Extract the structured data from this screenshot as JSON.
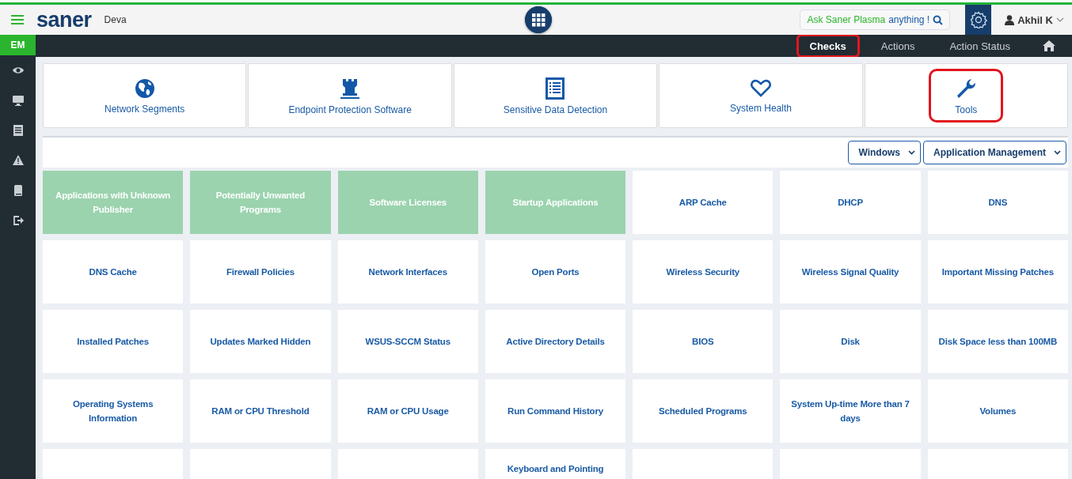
{
  "header": {
    "brand": "saner",
    "workspace": "Deva",
    "ask_prompt": {
      "lead": "Ask Saner Plasma",
      "tail": "anything !"
    },
    "user": "Akhil K"
  },
  "sidebar": {
    "badge": "EM"
  },
  "nav_tabs": [
    {
      "label": "Checks",
      "selected": true,
      "highlighted": true
    },
    {
      "label": "Actions",
      "selected": false,
      "highlighted": false
    },
    {
      "label": "Action Status",
      "selected": false,
      "highlighted": false
    }
  ],
  "categories": [
    {
      "label": "Network Segments",
      "highlighted": false
    },
    {
      "label": "Endpoint Protection Software",
      "highlighted": false
    },
    {
      "label": "Sensitive Data Detection",
      "highlighted": false
    },
    {
      "label": "System Health",
      "highlighted": false
    },
    {
      "label": "Tools",
      "highlighted": true
    }
  ],
  "filters": [
    {
      "value": "Windows"
    },
    {
      "value": "Application Management"
    }
  ],
  "checks": [
    {
      "label": "Applications with Unknown Publisher",
      "selected": true
    },
    {
      "label": "Potentially Unwanted Programs",
      "selected": true
    },
    {
      "label": "Software Licenses",
      "selected": true
    },
    {
      "label": "Startup Applications",
      "selected": true
    },
    {
      "label": "ARP Cache",
      "selected": false
    },
    {
      "label": "DHCP",
      "selected": false
    },
    {
      "label": "DNS",
      "selected": false
    },
    {
      "label": "DNS Cache",
      "selected": false
    },
    {
      "label": "Firewall Policies",
      "selected": false
    },
    {
      "label": "Network Interfaces",
      "selected": false
    },
    {
      "label": "Open Ports",
      "selected": false
    },
    {
      "label": "Wireless Security",
      "selected": false
    },
    {
      "label": "Wireless Signal Quality",
      "selected": false
    },
    {
      "label": "Important Missing Patches",
      "selected": false
    },
    {
      "label": "Installed Patches",
      "selected": false
    },
    {
      "label": "Updates Marked Hidden",
      "selected": false
    },
    {
      "label": "WSUS-SCCM Status",
      "selected": false
    },
    {
      "label": "Active Directory Details",
      "selected": false
    },
    {
      "label": "BIOS",
      "selected": false
    },
    {
      "label": "Disk",
      "selected": false
    },
    {
      "label": "Disk Space less than 100MB",
      "selected": false
    },
    {
      "label": "Operating Systems Information",
      "selected": false
    },
    {
      "label": "RAM or CPU Threshold",
      "selected": false
    },
    {
      "label": "RAM or CPU Usage",
      "selected": false
    },
    {
      "label": "Run Command History",
      "selected": false
    },
    {
      "label": "Scheduled Programs",
      "selected": false
    },
    {
      "label": "System Up-time More than 7 days",
      "selected": false
    },
    {
      "label": "Volumes",
      "selected": false
    },
    {
      "selected": false
    },
    {
      "selected": false
    },
    {
      "selected": false
    },
    {
      "label": "Keyboard and Pointing",
      "selected": false
    },
    {
      "selected": false
    },
    {
      "selected": false
    },
    {
      "selected": false
    }
  ]
}
